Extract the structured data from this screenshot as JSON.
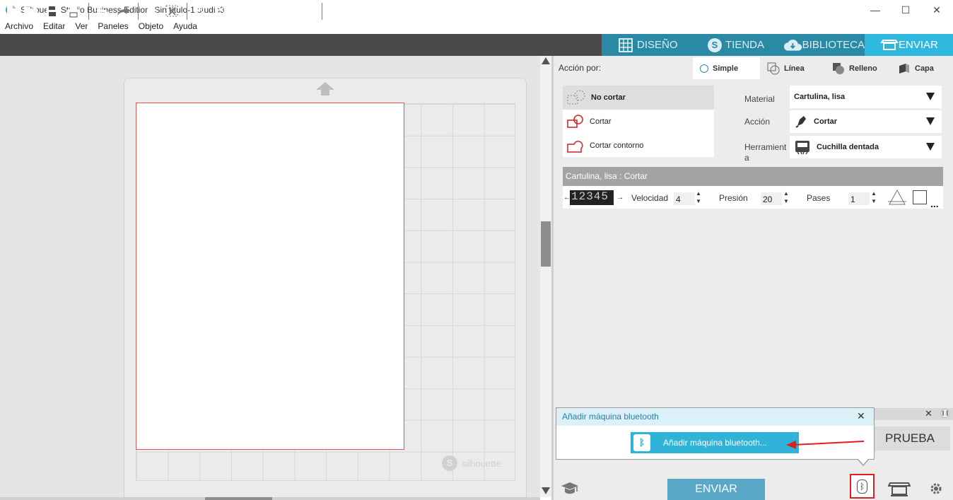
{
  "window": {
    "title": "Silhouette Studio Business Edition: Sin título-1.studio3",
    "logo_letter": "S",
    "minimize": "—",
    "maximize": "☐",
    "close": "✕"
  },
  "menu": [
    "Archivo",
    "Editar",
    "Ver",
    "Paneles",
    "Objeto",
    "Ayuda"
  ],
  "top_tabs": [
    {
      "label": "DISEÑO",
      "icon": "grid-icon"
    },
    {
      "label": "TIENDA",
      "icon": "silhouette-s-icon"
    },
    {
      "label": "BIBLIOTECA",
      "icon": "cloud-download-icon"
    },
    {
      "label": "ENVIAR",
      "icon": "cutter-icon",
      "active": true
    }
  ],
  "mat": {
    "brand": "silhouette",
    "brand_logo": "S"
  },
  "panel": {
    "accion_label": "Acción por:",
    "mode_tabs": [
      {
        "label": "Simple",
        "active": true
      },
      {
        "label": "Línea"
      },
      {
        "label": "Relleno"
      },
      {
        "label": "Capa"
      }
    ],
    "cut_options": [
      {
        "label": "No cortar",
        "selected": true
      },
      {
        "label": "Cortar"
      },
      {
        "label": "Cortar contorno"
      }
    ],
    "material": {
      "label": "Material",
      "value": "Cartulina, lisa"
    },
    "accion": {
      "label": "Acción",
      "value": "Cortar"
    },
    "herramienta": {
      "label": "Herramient\na",
      "value": "Cuchilla dentada"
    },
    "summary": "Cartulina, lisa : Cortar",
    "params": {
      "blade_digits": "12345",
      "velocidad_label": "Velocidad",
      "velocidad": "4",
      "presion_label": "Presión",
      "presion": "20",
      "pases_label": "Pases",
      "pases": "1",
      "more": "..."
    }
  },
  "bluetooth_popup": {
    "title": "Añadir máquina bluetooth",
    "close": "✕",
    "button_label": "Añadir máquina bluetooth...",
    "button_icon": "ᛒ"
  },
  "prueba_label": "PRUEBA",
  "enviar_label": "ENVIAR",
  "bt_icon_glyph": "ᛒ",
  "colors": {
    "accent": "#2fb8dd",
    "toolbar": "#4a4a4a",
    "tab_strip": "#2a8aa6",
    "highlight_red": "#e02020"
  }
}
